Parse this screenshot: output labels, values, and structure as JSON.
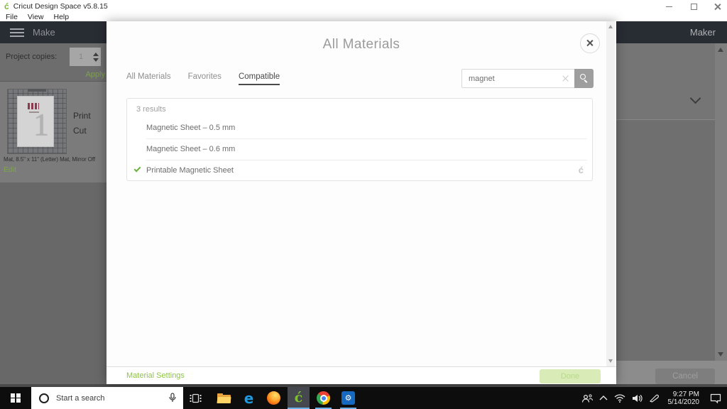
{
  "titlebar": {
    "app_title": "Cricut Design Space  v5.8.15"
  },
  "menubar": {
    "file": "File",
    "view": "View",
    "help": "Help"
  },
  "header": {
    "make": "Make",
    "maker": "Maker"
  },
  "sidebar": {
    "project_copies_label": "Project copies:",
    "copies_value": "1",
    "apply_label": "Apply",
    "print_label": "Print",
    "cut_label": "Cut",
    "mat_digit": "1",
    "mat_caption": "Mat, 8.5\" x 11\" (Letter) Mat, Mirror Off",
    "edit_label": "Edit"
  },
  "canvas": {
    "cancel_label": "Cancel"
  },
  "modal": {
    "title": "All Materials",
    "tabs": [
      {
        "label": "All Materials",
        "active": false
      },
      {
        "label": "Favorites",
        "active": false
      },
      {
        "label": "Compatible",
        "active": true
      }
    ],
    "search": {
      "value": "magnet"
    },
    "results": {
      "count_label": "3 results",
      "items": [
        {
          "label": "Magnetic Sheet – 0.5 mm",
          "selected": false
        },
        {
          "label": "Magnetic Sheet – 0.6 mm",
          "selected": false
        },
        {
          "label": "Printable Magnetic Sheet",
          "selected": true
        }
      ]
    },
    "footer": {
      "material_settings": "Material Settings",
      "done": "Done"
    }
  },
  "taskbar": {
    "search_placeholder": "Start a search",
    "time": "9:27 PM",
    "date": "5/14/2020"
  },
  "icons": {
    "cricut_glyph": "ć",
    "edge_glyph": "e",
    "gear_glyph": "⚙"
  },
  "colors": {
    "accent_green": "#8dc63f",
    "selected_check": "#6cb33e",
    "running_underline": "#6cb0e8",
    "dark_header": "#282c33"
  }
}
